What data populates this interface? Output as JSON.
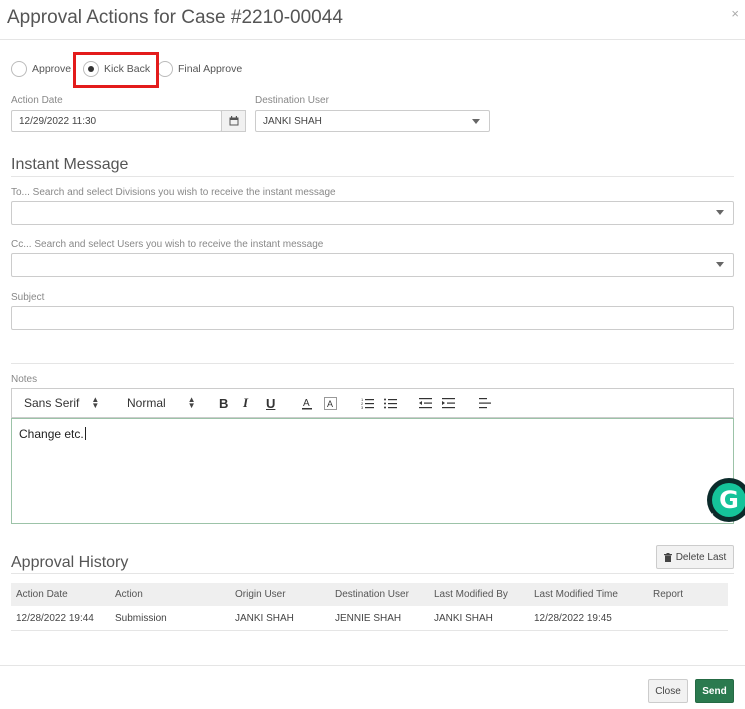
{
  "dialog": {
    "title": "Approval Actions for Case #2210-00044",
    "close_glyph": "×"
  },
  "actions": {
    "options": [
      {
        "label": "Approve",
        "checked": false
      },
      {
        "label": "Kick Back",
        "checked": true
      },
      {
        "label": "Final Approve",
        "checked": false
      }
    ]
  },
  "form": {
    "action_date_label": "Action Date",
    "action_date_value": "12/29/2022 11:30",
    "destination_user_label": "Destination User",
    "destination_user_value": "JANKI SHAH"
  },
  "instant_message": {
    "title": "Instant Message",
    "to_label": "To... Search and select Divisions you wish to receive the instant message",
    "cc_label": "Cc... Search and select Users you wish to receive the instant message",
    "subject_label": "Subject",
    "subject_value": ""
  },
  "notes": {
    "label": "Notes",
    "font_value": "Sans Serif",
    "size_value": "Normal",
    "content": "Change etc."
  },
  "history": {
    "title": "Approval History",
    "delete_last_label": "Delete Last",
    "columns": [
      "Action Date",
      "Action",
      "Origin User",
      "Destination User",
      "Last Modified By",
      "Last Modified Time",
      "Report"
    ],
    "rows": [
      [
        "12/28/2022 19:44",
        "Submission",
        "JANKI SHAH",
        "JENNIE SHAH",
        "JANKI SHAH",
        "12/28/2022 19:45",
        ""
      ]
    ]
  },
  "footer": {
    "close_label": "Close",
    "send_label": "Send"
  },
  "colors": {
    "send": "#2b7a4f",
    "highlight": "#e31b1b",
    "grammarly": "#15c39a"
  }
}
